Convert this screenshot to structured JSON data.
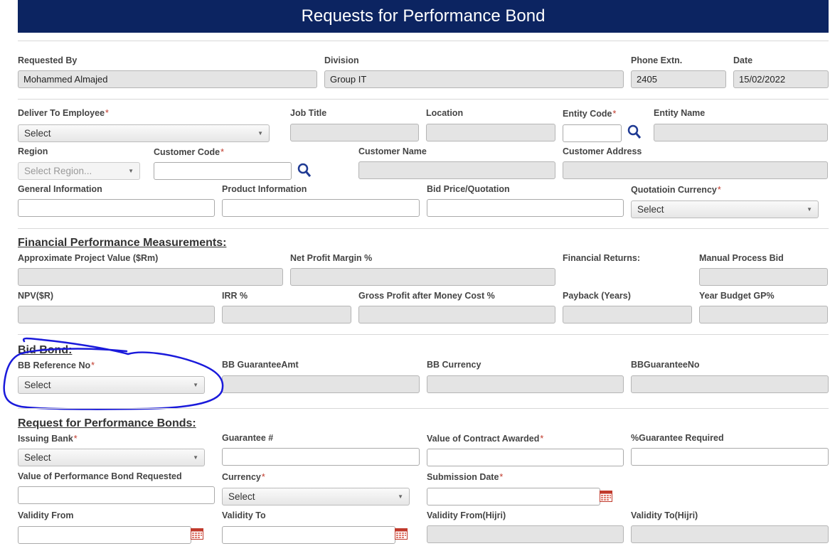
{
  "title": "Requests for Performance Bond",
  "row1": {
    "requested_by": {
      "label": "Requested By",
      "value": "Mohammed Almajed"
    },
    "division": {
      "label": "Division",
      "value": "Group IT"
    },
    "phone": {
      "label": "Phone Extn.",
      "value": "2405"
    },
    "date": {
      "label": "Date",
      "value": "15/02/2022"
    }
  },
  "row2": {
    "deliver_to": {
      "label": "Deliver To Employee",
      "value": "Select"
    },
    "job_title": {
      "label": "Job Title"
    },
    "location": {
      "label": "Location"
    },
    "entity_code": {
      "label": "Entity Code"
    },
    "entity_name": {
      "label": "Entity Name"
    }
  },
  "row3": {
    "region": {
      "label": "Region",
      "value": "Select Region..."
    },
    "customer_code": {
      "label": "Customer Code"
    },
    "customer_name": {
      "label": "Customer Name"
    },
    "customer_address": {
      "label": "Customer Address"
    }
  },
  "row4": {
    "general_info": {
      "label": "General Information"
    },
    "product_info": {
      "label": "Product Information"
    },
    "bid_price": {
      "label": "Bid Price/Quotation"
    },
    "quotation_currency": {
      "label": "Quotatioin Currency",
      "value": "Select"
    }
  },
  "financial": {
    "heading": "Financial Performance Measurements:",
    "project_value": {
      "label": "Approximate Project Value ($Rm)"
    },
    "net_profit": {
      "label": "Net Profit Margin %"
    },
    "financial_returns": {
      "label": "Financial Returns:"
    },
    "manual_process_bid": {
      "label": "Manual Process Bid"
    },
    "npv": {
      "label": "NPV($R)"
    },
    "irr": {
      "label": "IRR %"
    },
    "gross_profit": {
      "label": "Gross Profit after Money Cost %"
    },
    "payback": {
      "label": "Payback (Years)"
    },
    "year_budget": {
      "label": "Year Budget GP%"
    }
  },
  "bid_bond": {
    "heading": "Bid Bond:",
    "bb_reference": {
      "label": "BB Reference No",
      "value": "Select"
    },
    "bb_guarantee_amt": {
      "label": "BB GuaranteeAmt"
    },
    "bb_currency": {
      "label": "BB Currency"
    },
    "bb_guarantee_no": {
      "label": "BBGuaranteeNo"
    }
  },
  "performance_bonds": {
    "heading": "Request for Performance Bonds:",
    "issuing_bank": {
      "label": "Issuing Bank",
      "value": "Select"
    },
    "guarantee_no": {
      "label": "Guarantee #"
    },
    "contract_value": {
      "label": "Value of Contract Awarded"
    },
    "guarantee_required": {
      "label": "%Guarantee Required"
    },
    "bond_value": {
      "label": "Value of Performance Bond Requested"
    },
    "currency": {
      "label": "Currency",
      "value": "Select"
    },
    "submission_date": {
      "label": "Submission Date"
    },
    "validity_from": {
      "label": "Validity From"
    },
    "validity_to": {
      "label": "Validity To"
    },
    "validity_from_hijri": {
      "label": "Validity From(Hijri)"
    },
    "validity_to_hijri": {
      "label": "Validity To(Hijri)"
    }
  },
  "required_mark": "*",
  "colors": {
    "header_bg": "#0c2461",
    "required": "#c0392b",
    "annotation": "#1a1adb",
    "icon": "#1f3a93"
  }
}
